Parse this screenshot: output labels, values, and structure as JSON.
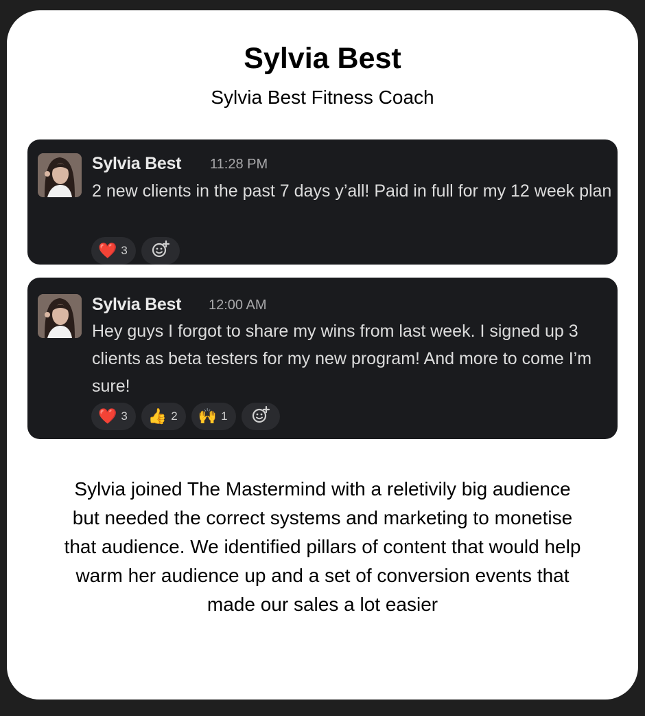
{
  "header": {
    "title": "Sylvia Best",
    "subtitle": "Sylvia Best Fitness Coach"
  },
  "messages": [
    {
      "author": "Sylvia Best",
      "time": "11:28 PM",
      "text": "2 new clients in the past 7 days y’all! Paid in full for my 12 week plan",
      "reactions": [
        {
          "emoji": "❤️",
          "count": "3",
          "icon": "red-heart-icon"
        }
      ]
    },
    {
      "author": "Sylvia Best",
      "time": "12:00 AM",
      "text": "Hey guys I forgot to share my wins from last week. I signed up 3 clients as beta testers for my new program! And more to come I’m sure!",
      "reactions": [
        {
          "emoji": "❤️",
          "count": "3",
          "icon": "red-heart-icon"
        },
        {
          "emoji": "👍",
          "count": "2",
          "icon": "thumbs-up-icon"
        },
        {
          "emoji": "🙌",
          "count": "1",
          "icon": "raised-hands-icon"
        }
      ]
    }
  ],
  "description": "Sylvia joined The Mastermind with a reletivily big audience but needed the correct systems and marketing to monetise that audience. We identified pillars of content that would help warm her audience up and a set of conversion events that made our sales a lot easier",
  "colors": {
    "page_background": "#1f1f1f",
    "card_background": "#ffffff",
    "message_background": "#1a1b1e",
    "reaction_background": "#2a2b2f"
  },
  "icons": {
    "add_reaction": "add-reaction-icon",
    "avatar": "avatar-photo"
  }
}
